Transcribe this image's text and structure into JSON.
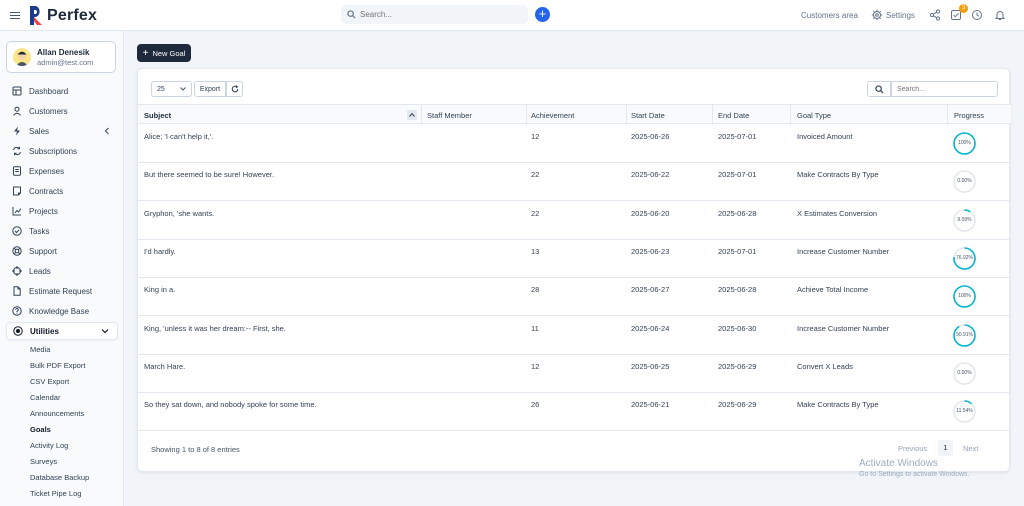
{
  "app": {
    "brand": "Perfex"
  },
  "header": {
    "search_placeholder": "Search...",
    "customers_area": "Customers area",
    "settings": "Settings",
    "tasks_badge": "3"
  },
  "user": {
    "name": "Allan Denesik",
    "email": "admin@test.com"
  },
  "sidebar": {
    "items": [
      {
        "label": "Dashboard",
        "icon": "home-icon"
      },
      {
        "label": "Customers",
        "icon": "user-icon"
      },
      {
        "label": "Sales",
        "icon": "bolt-icon"
      },
      {
        "label": "Subscriptions",
        "icon": "refresh-icon"
      },
      {
        "label": "Expenses",
        "icon": "receipt-icon"
      },
      {
        "label": "Contracts",
        "icon": "document-icon"
      },
      {
        "label": "Projects",
        "icon": "chart-icon"
      },
      {
        "label": "Tasks",
        "icon": "check-circle-icon"
      },
      {
        "label": "Support",
        "icon": "lifebuoy-icon"
      },
      {
        "label": "Leads",
        "icon": "target-icon"
      },
      {
        "label": "Estimate Request",
        "icon": "file-icon"
      },
      {
        "label": "Knowledge Base",
        "icon": "question-icon"
      },
      {
        "label": "Utilities",
        "icon": "utilities-icon"
      }
    ],
    "sub_items": [
      "Media",
      "Bulk PDF Export",
      "CSV Export",
      "Calendar",
      "Announcements",
      "Goals",
      "Activity Log",
      "Surveys",
      "Database Backup",
      "Ticket Pipe Log"
    ]
  },
  "toolbar": {
    "new_goal": "New Goal",
    "page_size": "25",
    "export": "Export",
    "search_placeholder": "Search..."
  },
  "table": {
    "columns": [
      "Subject",
      "Staff Member",
      "Achievement",
      "Start Date",
      "End Date",
      "Goal Type",
      "Progress"
    ],
    "rows": [
      {
        "subject": "Alice; 'I can't help it,'.",
        "staff": "",
        "achievement": "12",
        "start": "2025-06-26",
        "end": "2025-07-01",
        "type": "Invoiced Amount",
        "progress": 100,
        "progress_label": "100%"
      },
      {
        "subject": "But there seemed to be sure! However.",
        "staff": "",
        "achievement": "22",
        "start": "2025-06-22",
        "end": "2025-07-01",
        "type": "Make Contracts By Type",
        "progress": 0,
        "progress_label": "0.00%"
      },
      {
        "subject": "Gryphon, 'she wants.",
        "staff": "",
        "achievement": "22",
        "start": "2025-06-20",
        "end": "2025-06-28",
        "type": "X Estimates Conversion",
        "progress": 9.09,
        "progress_label": "9.09%"
      },
      {
        "subject": "I'd hardly.",
        "staff": "",
        "achievement": "13",
        "start": "2025-06-23",
        "end": "2025-07-01",
        "type": "Increase Customer Number",
        "progress": 76.92,
        "progress_label": "76.92%"
      },
      {
        "subject": "King in a.",
        "staff": "",
        "achievement": "28",
        "start": "2025-06-27",
        "end": "2025-06-28",
        "type": "Achieve Total Income",
        "progress": 100,
        "progress_label": "100%"
      },
      {
        "subject": "King, 'unless it was her dream:-- First, she.",
        "staff": "",
        "achievement": "11",
        "start": "2025-06-24",
        "end": "2025-06-30",
        "type": "Increase Customer Number",
        "progress": 90.91,
        "progress_label": "90.91%"
      },
      {
        "subject": "March Hare.",
        "staff": "",
        "achievement": "12",
        "start": "2025-06-25",
        "end": "2025-06-29",
        "type": "Convert X Leads",
        "progress": 0,
        "progress_label": "0.00%"
      },
      {
        "subject": "So they sat down, and nobody spoke for some time.",
        "staff": "",
        "achievement": "26",
        "start": "2025-06-21",
        "end": "2025-06-29",
        "type": "Make Contracts By Type",
        "progress": 11.54,
        "progress_label": "11.54%"
      }
    ]
  },
  "footer": {
    "info": "Showing 1 to 8 of 8 entries",
    "previous": "Previous",
    "page": "1",
    "next": "Next"
  },
  "watermark": {
    "title": "Activate Windows",
    "subtitle": "Go to Settings to activate Windows."
  },
  "colors": {
    "accent": "#06b6d4",
    "primary": "#2563eb",
    "dark": "#1e293b",
    "ring_bg": "#e5e7eb"
  }
}
